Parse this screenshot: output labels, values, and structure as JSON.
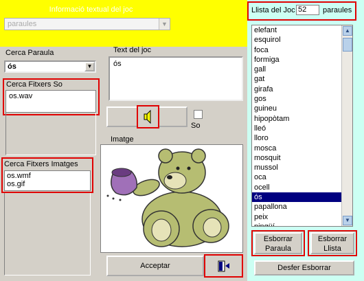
{
  "header": {
    "title": "Informació textual del joc",
    "category_select": "paraules"
  },
  "search_word": {
    "label": "Cerca Paraula",
    "value": "ós"
  },
  "game_text": {
    "label": "Text del joc",
    "value": "ós"
  },
  "sound_files": {
    "label": "Cerca Fitxers So",
    "items": [
      "os.wav"
    ]
  },
  "image_files": {
    "label": "Cerca Fitxers Imatges",
    "items": [
      "os.wmf",
      "os.gif"
    ]
  },
  "sound_controls": {
    "checkbox_label": "So"
  },
  "image": {
    "label": "Imatge"
  },
  "buttons": {
    "accept": "Acceptar",
    "delete_word": "Esborrar\nParaula",
    "delete_list": "Esborrar\nLlista",
    "undo_delete": "Desfer Esborrar"
  },
  "word_list": {
    "label": "Llista del Joc",
    "count": "52",
    "unit": "paraules",
    "selected": "ós",
    "items": [
      "elefant",
      "esquirol",
      "foca",
      "formiga",
      "gall",
      "gat",
      "girafa",
      "gos",
      "guineu",
      "hipopòtam",
      "lleó",
      "lloro",
      "mosca",
      "mosquit",
      "mussol",
      "oca",
      "ocell",
      "ós",
      "papallona",
      "peix",
      "pingüí"
    ]
  },
  "colors": {
    "header_bg": "#ffff00",
    "list_panel_bg": "#ccfff3",
    "highlight_border": "#e00000",
    "selection_bg": "#000080"
  }
}
